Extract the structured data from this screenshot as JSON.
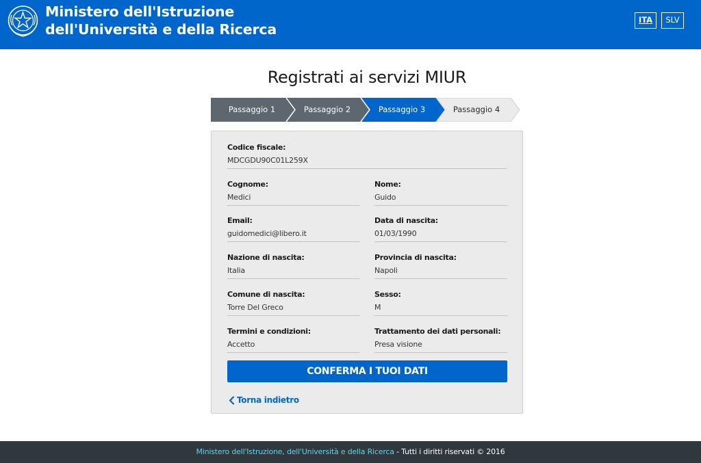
{
  "header": {
    "title_line1": "Ministero dell'Istruzione",
    "title_line2": "dell'Università e della Ricerca",
    "lang_ita": "ITA",
    "lang_slv": "SLV",
    "bg_color": "#0066cc"
  },
  "page": {
    "title": "Registrati ai servizi MIUR"
  },
  "stepper": {
    "steps": [
      {
        "label": "Passaggio 1",
        "state": "done"
      },
      {
        "label": "Passaggio 2",
        "state": "done"
      },
      {
        "label": "Passaggio 3",
        "state": "active"
      },
      {
        "label": "Passaggio 4",
        "state": "pending"
      }
    ],
    "done_color": "#5c6770",
    "active_color": "#0066cc",
    "pending_color": "#ebebeb"
  },
  "form": {
    "codice_fiscale": {
      "label": "Codice fiscale:",
      "value": "MDCGDU90C01L259X"
    },
    "cognome": {
      "label": "Cognome:",
      "value": "Medici"
    },
    "nome": {
      "label": "Nome:",
      "value": "Guido"
    },
    "email": {
      "label": "Email:",
      "value": "guidomedici@libero.it"
    },
    "data_nascita": {
      "label": "Data di nascita:",
      "value": "01/03/1990"
    },
    "nazione_nascita": {
      "label": "Nazione di nascita:",
      "value": "Italia"
    },
    "provincia_nascita": {
      "label": "Provincia di nascita:",
      "value": "Napoli"
    },
    "comune_nascita": {
      "label": "Comune di nascita:",
      "value": "Torre Del Greco"
    },
    "sesso": {
      "label": "Sesso:",
      "value": "M"
    },
    "termini": {
      "label": "Termini e condizioni:",
      "value": "Accetto"
    },
    "trattamento": {
      "label": "Trattamento dei dati personali:",
      "value": "Presa visione"
    },
    "confirm_label": "CONFERMA I TUOI DATI",
    "back_label": "Torna indietro"
  },
  "footer": {
    "link_text": "Ministero dell'Istruzione, dell'Università e della Ricerca",
    "rest_text": " - Tutti i diritti riservati © 2016"
  }
}
